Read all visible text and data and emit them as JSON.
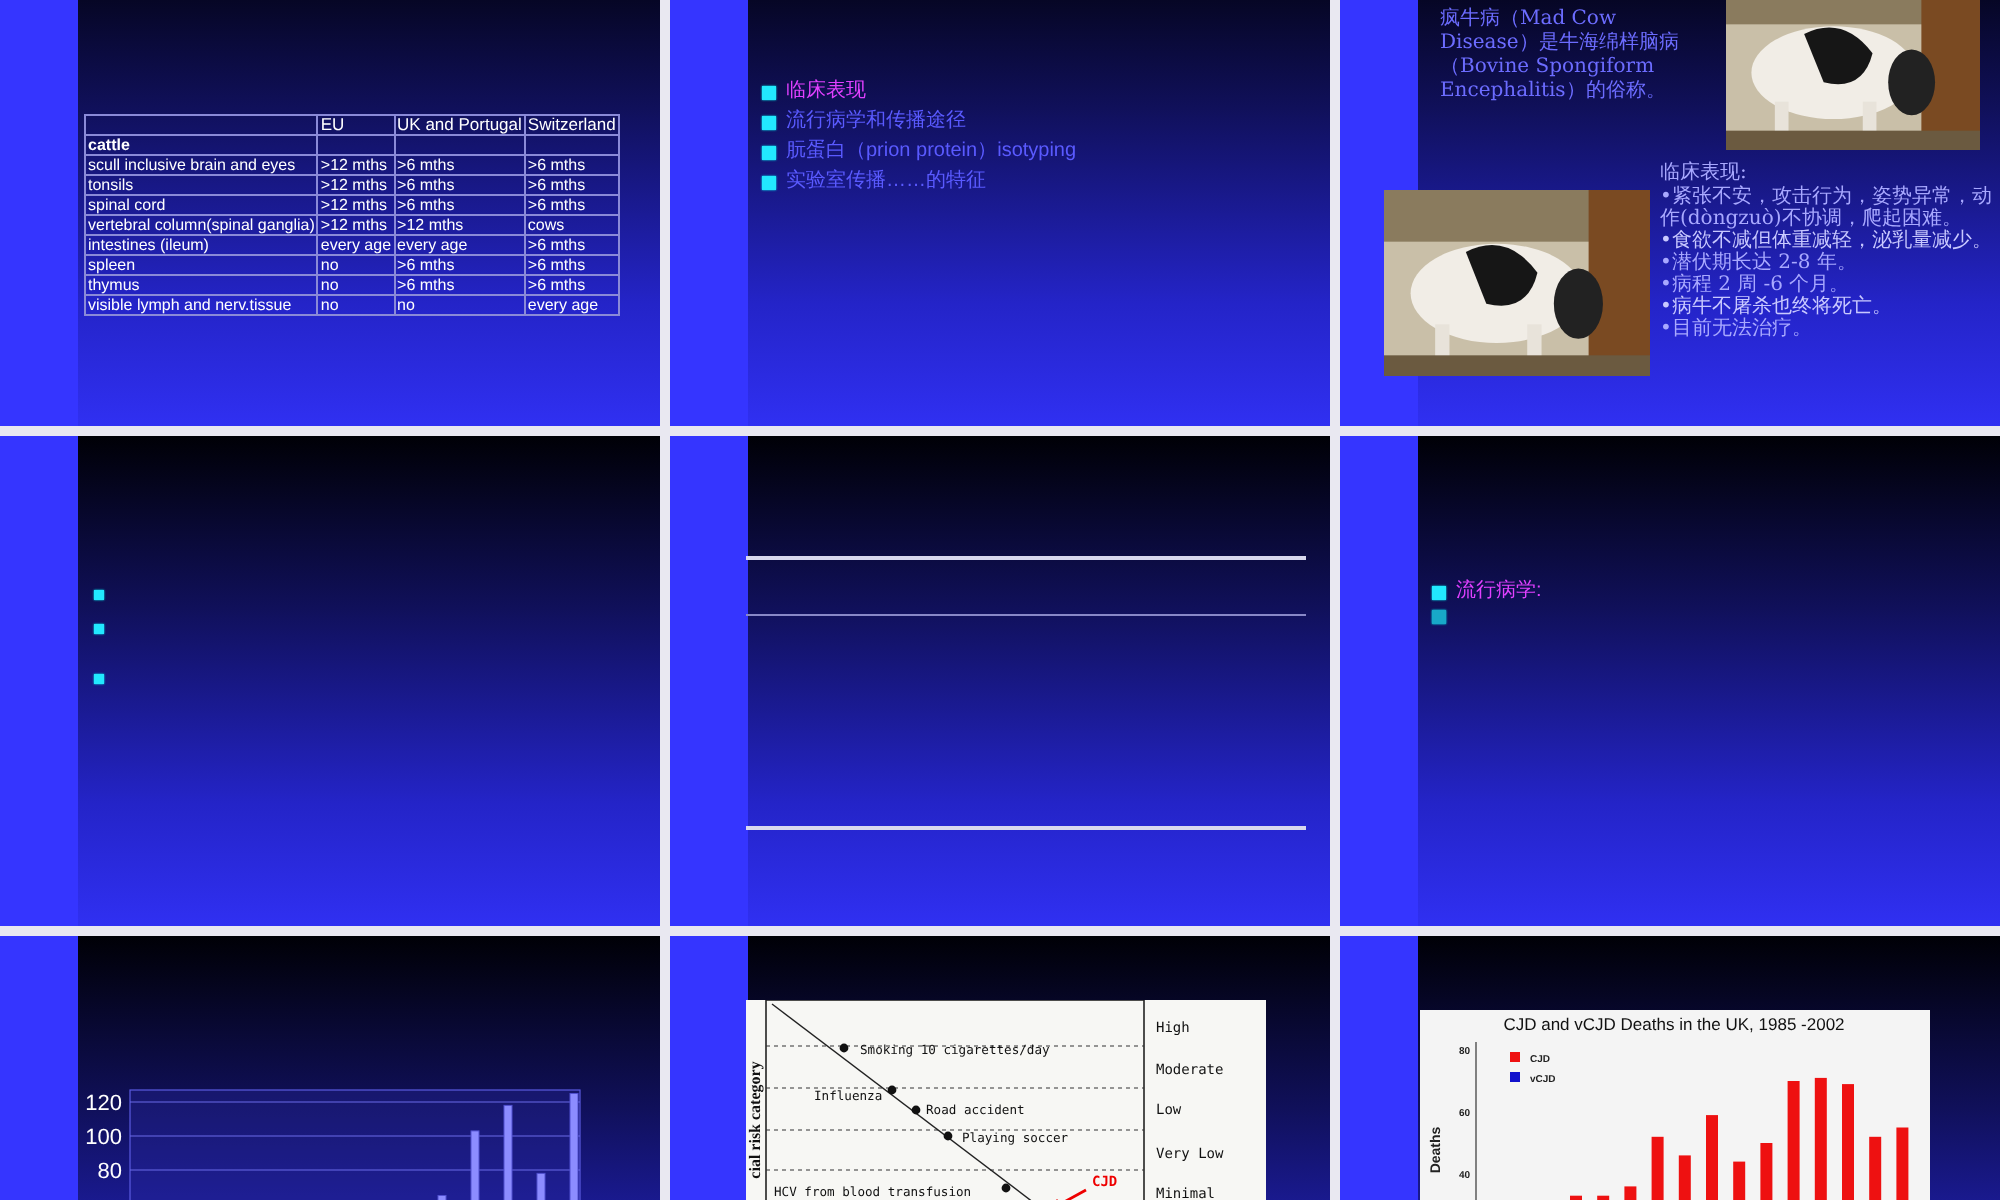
{
  "slides": [
    {
      "kind": "table",
      "table": {
        "columns": [
          "EU",
          "UK and Portugal",
          "Switzerland"
        ],
        "rows": [
          {
            "kind": "group",
            "label": "cattle"
          },
          {
            "kind": "data",
            "label": "scull inclusive brain and eyes",
            "cells": [
              ">12 mths",
              ">6 mths",
              ">6 mths"
            ]
          },
          {
            "kind": "data",
            "label": "tonsils",
            "cells": [
              ">12 mths",
              ">6 mths",
              ">6 mths"
            ]
          },
          {
            "kind": "data",
            "label": "spinal cord",
            "cells": [
              ">12 mths",
              ">6 mths",
              ">6 mths"
            ]
          },
          {
            "kind": "data",
            "label": "vertebral column(spinal ganglia)",
            "cells": [
              ">12 mths",
              ">12 mths",
              "cows"
            ]
          },
          {
            "kind": "data",
            "label": "intestines (ileum)",
            "cells": [
              "every age",
              "every age",
              ">6 mths"
            ]
          },
          {
            "kind": "data",
            "label": "spleen",
            "cells": [
              "no",
              ">6 mths",
              ">6 mths"
            ]
          },
          {
            "kind": "data",
            "label": "thymus",
            "cells": [
              "no",
              ">6 mths",
              ">6 mths"
            ]
          },
          {
            "kind": "data",
            "label": "visible lymph and nerv.tissue",
            "cells": [
              "no",
              "no",
              "every age"
            ]
          }
        ]
      }
    },
    {
      "kind": "bullets",
      "bullets": [
        {
          "text": "临床表现",
          "highlighted": true
        },
        {
          "text": "流行病学和传播途径",
          "highlighted": false
        },
        {
          "text": "朊蛋白（prion protein）isotyping",
          "highlighted": false
        },
        {
          "text": "实验室传播……的特征",
          "highlighted": false
        }
      ]
    },
    {
      "kind": "article",
      "intro": "疯牛病（Mad Cow Disease）是牛海绵样脑病（Bovine Spongiform Encephalitis）的俗称。",
      "heading": "临床表现:",
      "points": [
        {
          "text": "•紧张不安，攻击行为，姿势异常，动作(dòngzuò)不协调，爬起困难。",
          "small": false
        },
        {
          "text": "•食欲不减但体重减轻，泌乳量减少。",
          "small": true
        },
        {
          "text": "•潜伏期长达 2-8 年。",
          "small": false
        },
        {
          "text": "•病程 2 周 -6 个月。",
          "small": false
        },
        {
          "text": "•病牛不屠杀也终将死亡。",
          "small": true
        },
        {
          "text": "•目前无法治疗。",
          "small": false
        }
      ]
    },
    {
      "kind": "outline",
      "markers": [
        {
          "kind": "square"
        },
        {
          "kind": "square"
        },
        {
          "kind": "square"
        }
      ]
    },
    {
      "kind": "rules",
      "rules": [
        {
          "kind": "thick"
        },
        {
          "kind": "thin"
        },
        {
          "kind": "thick"
        }
      ]
    },
    {
      "kind": "bullets",
      "bullets": [
        {
          "text": "流行病学:",
          "highlighted": true
        },
        {
          "highlighted": false
        }
      ]
    },
    {
      "kind": "bar_chart_picture",
      "tick_labels": [
        "120",
        "100",
        "80"
      ]
    },
    {
      "kind": "risk_scale",
      "axis_label": "cial risk category",
      "activities": [
        "Smoking 10 cigarettes/day",
        "Influenza",
        "Road accident",
        "Playing soccer",
        "HCV from blood transfusion"
      ],
      "marker": "CJD",
      "levels": [
        "High",
        "Moderate",
        "Low",
        "Very Low",
        "Minimal"
      ]
    },
    {
      "kind": "deaths_chart",
      "title": "CJD and vCJD Deaths in the UK, 1985 -2002",
      "axis_label": "Deaths",
      "tick_labels": [
        "80",
        "60",
        "40"
      ],
      "legend": [
        {
          "name": "CJD",
          "color": "#ee1111"
        },
        {
          "name": "vCJD",
          "color": "#1111cc"
        }
      ]
    }
  ]
}
